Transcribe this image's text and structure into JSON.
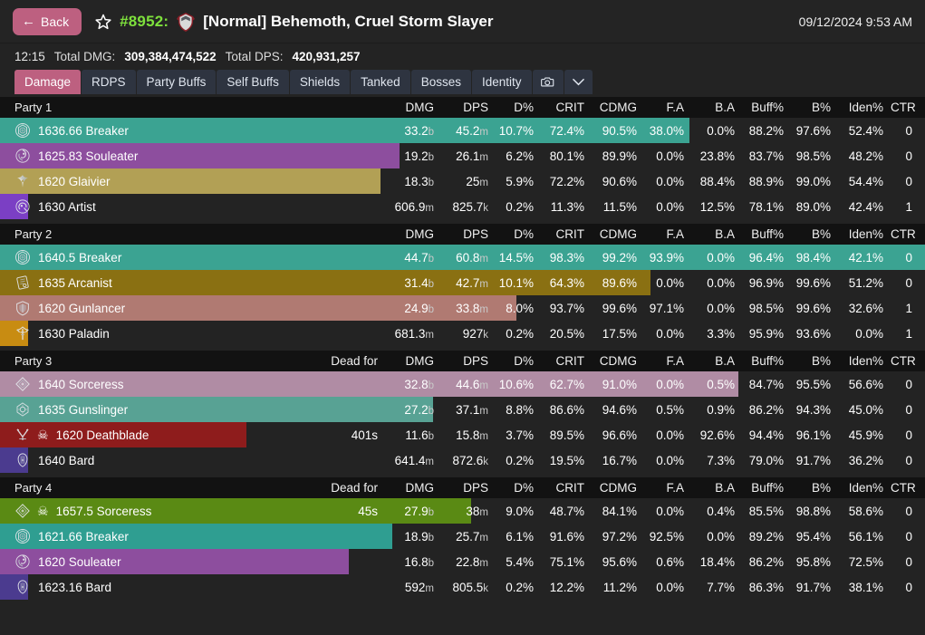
{
  "header": {
    "back_label": "Back",
    "star_icon": "star-outline-icon",
    "raid_id": "#8952:",
    "boss_icon": "boss-helm-icon",
    "boss_title": "[Normal] Behemoth, Cruel Storm Slayer",
    "timestamp": "09/12/2024 9:53 AM",
    "accent_color": "#bd6080",
    "raid_id_color": "#7ee03c"
  },
  "summary": {
    "duration": "12:15",
    "total_dmg_label": "Total DMG:",
    "total_dmg_value": "309,384,474,522",
    "total_dps_label": "Total DPS:",
    "total_dps_value": "420,931,257"
  },
  "tabs": [
    {
      "label": "Damage",
      "active": true
    },
    {
      "label": "RDPS",
      "active": false
    },
    {
      "label": "Party Buffs",
      "active": false
    },
    {
      "label": "Self Buffs",
      "active": false
    },
    {
      "label": "Shields",
      "active": false
    },
    {
      "label": "Tanked",
      "active": false
    },
    {
      "label": "Bosses",
      "active": false
    },
    {
      "label": "Identity",
      "active": false
    }
  ],
  "tab_icons": [
    {
      "name": "camera-icon"
    },
    {
      "name": "chevron-down-icon"
    }
  ],
  "columns": {
    "dead": "Dead for",
    "dmg": "DMG",
    "dps": "DPS",
    "dpct": "D%",
    "crit": "CRIT",
    "cdmg": "CDMG",
    "fa": "F.A",
    "ba": "B.A",
    "buff": "Buff%",
    "b": "B%",
    "iden": "Iden%",
    "ctr": "CTR"
  },
  "parties": [
    {
      "name": "Party 1",
      "show_dead_column": false,
      "players": [
        {
          "icon": "breaker-icon",
          "name": "1636.66 Breaker",
          "dead": "",
          "dmg": "33.2",
          "dmg_unit": "b",
          "dps": "45.2",
          "dps_unit": "m",
          "dpct": "10.7%",
          "crit": "72.4%",
          "cdmg": "90.5%",
          "fa": "38.0%",
          "ba": "0.0%",
          "buff": "88.2%",
          "b": "97.6%",
          "iden": "52.4%",
          "ctr": "0",
          "bar_color": "#3ba392",
          "bar_pct": 74.5,
          "dead_flag": false
        },
        {
          "icon": "souleater-icon",
          "name": "1625.83 Souleater",
          "dead": "",
          "dmg": "19.2",
          "dmg_unit": "b",
          "dps": "26.1",
          "dps_unit": "m",
          "dpct": "6.2%",
          "crit": "80.1%",
          "cdmg": "89.9%",
          "fa": "0.0%",
          "ba": "23.8%",
          "buff": "83.7%",
          "b": "98.5%",
          "iden": "48.2%",
          "ctr": "0",
          "bar_color": "#8d4e9e",
          "bar_pct": 43.2,
          "dead_flag": false
        },
        {
          "icon": "glaivier-icon",
          "name": "1620 Glaivier",
          "dead": "",
          "dmg": "18.3",
          "dmg_unit": "b",
          "dps": "25",
          "dps_unit": "m",
          "dpct": "5.9%",
          "crit": "72.2%",
          "cdmg": "90.6%",
          "fa": "0.0%",
          "ba": "88.4%",
          "buff": "88.9%",
          "b": "99.0%",
          "iden": "54.4%",
          "ctr": "0",
          "bar_color": "#b2a055",
          "bar_pct": 41.1,
          "dead_flag": false
        },
        {
          "icon": "artist-icon",
          "name": "1630 Artist",
          "dead": "",
          "dmg": "606.9",
          "dmg_unit": "m",
          "dps": "825.7",
          "dps_unit": "k",
          "dpct": "0.2%",
          "crit": "11.3%",
          "cdmg": "11.5%",
          "fa": "0.0%",
          "ba": "12.5%",
          "buff": "78.1%",
          "b": "89.0%",
          "iden": "42.4%",
          "ctr": "1",
          "bar_color": "#7b3fc4",
          "bar_pct": 3.0,
          "dead_flag": false
        }
      ]
    },
    {
      "name": "Party 2",
      "show_dead_column": false,
      "players": [
        {
          "icon": "breaker-icon",
          "name": "1640.5 Breaker",
          "dead": "",
          "dmg": "44.7",
          "dmg_unit": "b",
          "dps": "60.8",
          "dps_unit": "m",
          "dpct": "14.5%",
          "crit": "98.3%",
          "cdmg": "99.2%",
          "fa": "93.9%",
          "ba": "0.0%",
          "buff": "96.4%",
          "b": "98.4%",
          "iden": "42.1%",
          "ctr": "0",
          "bar_color": "#3ba392",
          "bar_pct": 100,
          "dead_flag": false
        },
        {
          "icon": "arcanist-icon",
          "name": "1635 Arcanist",
          "dead": "",
          "dmg": "31.4",
          "dmg_unit": "b",
          "dps": "42.7",
          "dps_unit": "m",
          "dpct": "10.1%",
          "crit": "64.3%",
          "cdmg": "89.6%",
          "fa": "0.0%",
          "ba": "0.0%",
          "buff": "96.9%",
          "b": "99.6%",
          "iden": "51.2%",
          "ctr": "0",
          "bar_color": "#8a7012",
          "bar_pct": 70.3,
          "dead_flag": false
        },
        {
          "icon": "gunlancer-icon",
          "name": "1620 Gunlancer",
          "dead": "",
          "dmg": "24.9",
          "dmg_unit": "b",
          "dps": "33.8",
          "dps_unit": "m",
          "dpct": "8.0%",
          "crit": "93.7%",
          "cdmg": "99.6%",
          "fa": "97.1%",
          "ba": "0.0%",
          "buff": "98.5%",
          "b": "99.6%",
          "iden": "32.6%",
          "ctr": "1",
          "bar_color": "#b07a72",
          "bar_pct": 55.8,
          "dead_flag": false
        },
        {
          "icon": "paladin-icon",
          "name": "1630 Paladin",
          "dead": "",
          "dmg": "681.3",
          "dmg_unit": "m",
          "dps": "927",
          "dps_unit": "k",
          "dpct": "0.2%",
          "crit": "20.5%",
          "cdmg": "17.5%",
          "fa": "0.0%",
          "ba": "3.3%",
          "buff": "95.9%",
          "b": "93.6%",
          "iden": "0.0%",
          "ctr": "1",
          "bar_color": "#c88c12",
          "bar_pct": 3.0,
          "dead_flag": false
        }
      ]
    },
    {
      "name": "Party 3",
      "show_dead_column": true,
      "players": [
        {
          "icon": "sorceress-icon",
          "name": "1640 Sorceress",
          "dead": "",
          "dmg": "32.8",
          "dmg_unit": "b",
          "dps": "44.6",
          "dps_unit": "m",
          "dpct": "10.6%",
          "crit": "62.7%",
          "cdmg": "91.0%",
          "fa": "0.0%",
          "ba": "0.5%",
          "buff": "84.7%",
          "b": "95.5%",
          "iden": "56.6%",
          "ctr": "0",
          "bar_color": "#b08ca4",
          "bar_pct": 79.8,
          "dead_flag": false
        },
        {
          "icon": "gunslinger-icon",
          "name": "1635 Gunslinger",
          "dead": "",
          "dmg": "27.2",
          "dmg_unit": "b",
          "dps": "37.1",
          "dps_unit": "m",
          "dpct": "8.8%",
          "crit": "86.6%",
          "cdmg": "94.6%",
          "fa": "0.5%",
          "ba": "0.9%",
          "buff": "86.2%",
          "b": "94.3%",
          "iden": "45.0%",
          "ctr": "0",
          "bar_color": "#58a294",
          "bar_pct": 46.8,
          "dead_flag": false
        },
        {
          "icon": "deathblade-icon",
          "name": "1620 Deathblade",
          "dead": "401s",
          "dmg": "11.6",
          "dmg_unit": "b",
          "dps": "15.8",
          "dps_unit": "m",
          "dpct": "3.7%",
          "crit": "89.5%",
          "cdmg": "96.6%",
          "fa": "0.0%",
          "ba": "92.6%",
          "buff": "94.4%",
          "b": "96.1%",
          "iden": "45.9%",
          "ctr": "0",
          "bar_color": "#8e1c1c",
          "bar_pct": 26.6,
          "dead_flag": true
        },
        {
          "icon": "bard-icon",
          "name": "1640 Bard",
          "dead": "",
          "dmg": "641.4",
          "dmg_unit": "m",
          "dps": "872.6",
          "dps_unit": "k",
          "dpct": "0.2%",
          "crit": "19.5%",
          "cdmg": "16.7%",
          "fa": "0.0%",
          "ba": "7.3%",
          "buff": "79.0%",
          "b": "91.7%",
          "iden": "36.2%",
          "ctr": "0",
          "bar_color": "#4b3b8f",
          "bar_pct": 3.0,
          "dead_flag": false
        }
      ]
    },
    {
      "name": "Party 4",
      "show_dead_column": true,
      "players": [
        {
          "icon": "sorceress-icon",
          "name": "1657.5 Sorceress",
          "dead": "45s",
          "dmg": "27.9",
          "dmg_unit": "b",
          "dps": "38",
          "dps_unit": "m",
          "dpct": "9.0%",
          "crit": "48.7%",
          "cdmg": "84.1%",
          "fa": "0.0%",
          "ba": "0.4%",
          "buff": "85.5%",
          "b": "98.8%",
          "iden": "58.6%",
          "ctr": "0",
          "bar_color": "#5a8a14",
          "bar_pct": 50.9,
          "dead_flag": true
        },
        {
          "icon": "breaker-icon",
          "name": "1621.66 Breaker",
          "dead": "",
          "dmg": "18.9",
          "dmg_unit": "b",
          "dps": "25.7",
          "dps_unit": "m",
          "dpct": "6.1%",
          "crit": "91.6%",
          "cdmg": "97.2%",
          "fa": "92.5%",
          "ba": "0.0%",
          "buff": "89.2%",
          "b": "95.4%",
          "iden": "56.1%",
          "ctr": "0",
          "bar_color": "#2f9e91",
          "bar_pct": 42.4,
          "dead_flag": false
        },
        {
          "icon": "souleater-icon",
          "name": "1620 Souleater",
          "dead": "",
          "dmg": "16.8",
          "dmg_unit": "b",
          "dps": "22.8",
          "dps_unit": "m",
          "dpct": "5.4%",
          "crit": "75.1%",
          "cdmg": "95.6%",
          "fa": "0.6%",
          "ba": "18.4%",
          "buff": "86.2%",
          "b": "95.8%",
          "iden": "72.5%",
          "ctr": "0",
          "bar_color": "#8d4e9e",
          "bar_pct": 37.7,
          "dead_flag": false
        },
        {
          "icon": "bard-icon",
          "name": "1623.16 Bard",
          "dead": "",
          "dmg": "592",
          "dmg_unit": "m",
          "dps": "805.5",
          "dps_unit": "k",
          "dpct": "0.2%",
          "crit": "12.2%",
          "cdmg": "11.2%",
          "fa": "0.0%",
          "ba": "7.7%",
          "buff": "86.3%",
          "b": "91.7%",
          "iden": "38.1%",
          "ctr": "0",
          "bar_color": "#4b3b8f",
          "bar_pct": 3.0,
          "dead_flag": false
        }
      ]
    }
  ]
}
